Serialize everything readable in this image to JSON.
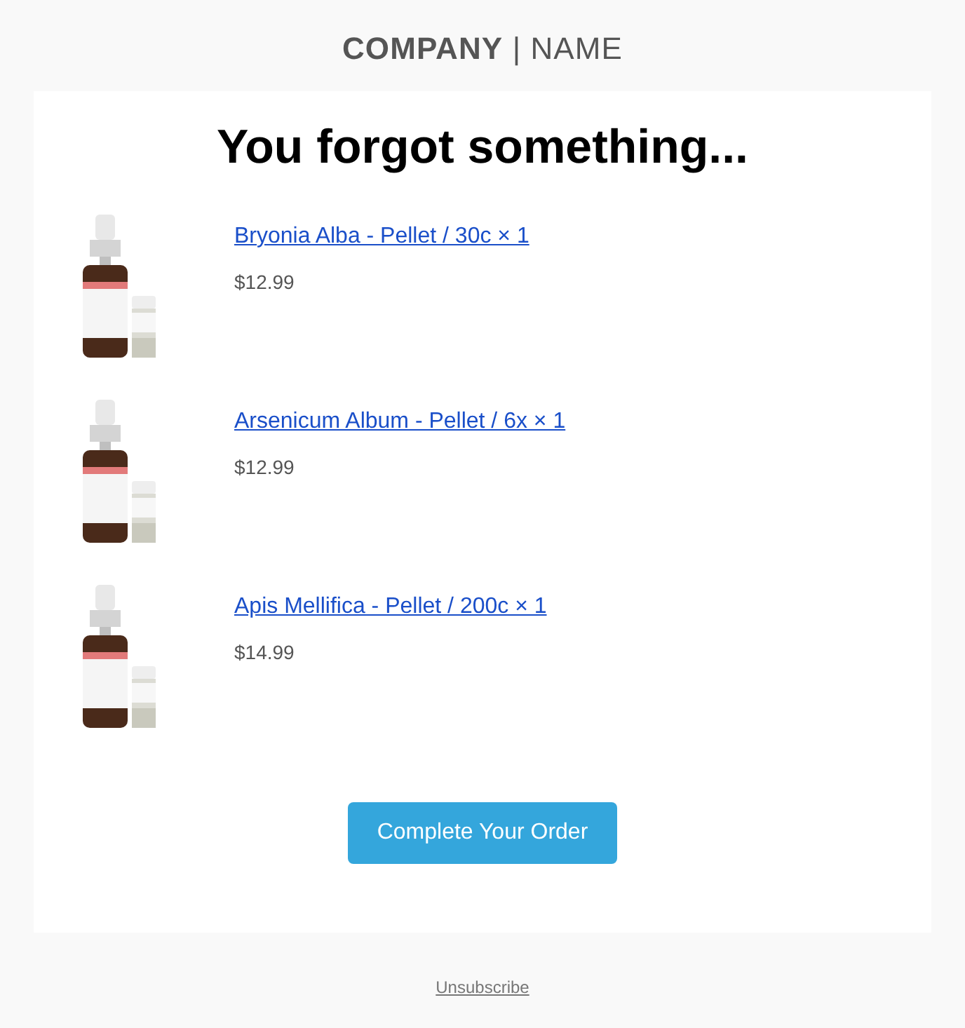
{
  "header": {
    "logo": "**COMPANY** | NAME"
  },
  "email": {
    "heading": "You forgot something...",
    "items": [
      {
        "kind": "picture",
        "title": "Bryonia Alba - Pellet / 30c × 1",
        "price": "$12.99"
      },
      {
        "kind": "picture",
        "title": "Arsenicum Album - Pellet / 6x × 1",
        "price": "$12.99"
      },
      {
        "kind": "picture",
        "title": "Apis Mellifica - Pellet / 200c × 1",
        "price": "$14.99"
      }
    ],
    "button": "Complete Your Order"
  },
  "footer": {
    "link": "Unsubscribe"
  }
}
